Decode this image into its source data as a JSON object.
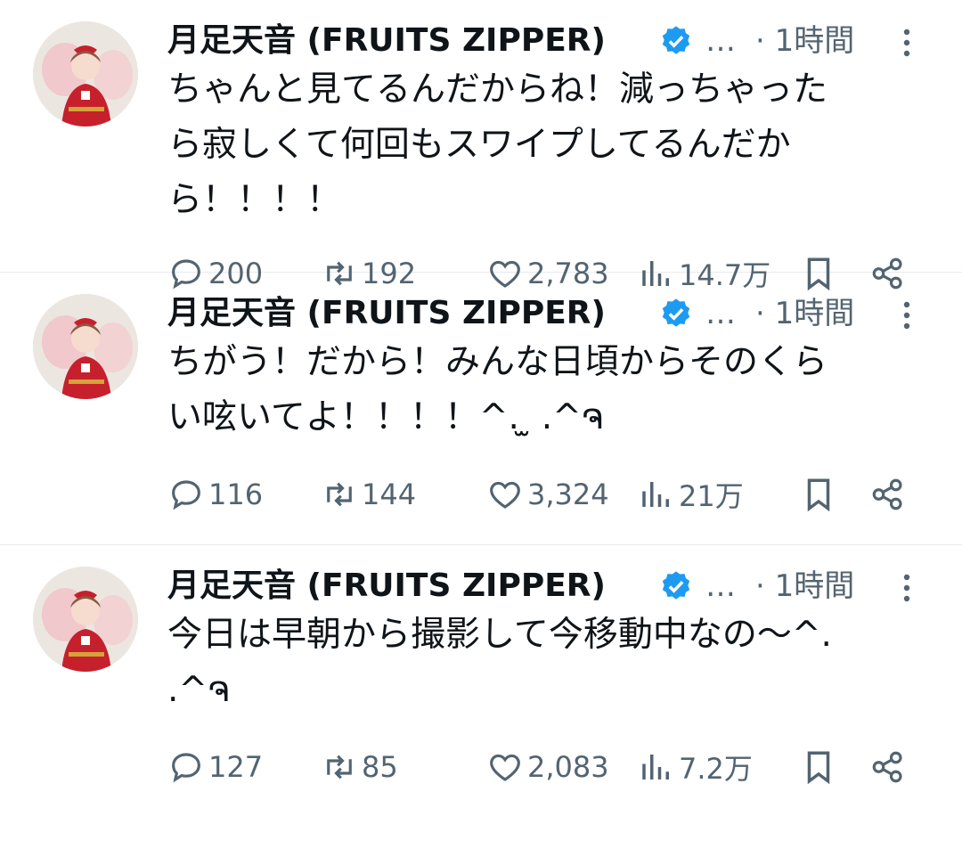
{
  "colors": {
    "text": "#0f1419",
    "secondary": "#536471",
    "verified": "#1d9bf0",
    "divider": "#e6e9ec"
  },
  "icons": {
    "reply": "speech-bubble-icon",
    "retweet": "retweet-arrows-icon",
    "like": "heart-icon",
    "views": "bar-chart-icon",
    "bookmark": "bookmark-icon",
    "share": "share-nodes-icon",
    "more": "vertical-dots-icon",
    "verified": "verified-badge-icon"
  },
  "tweets": [
    {
      "name": "月足天音 (FRUITS ZIPPER)",
      "handle": "…",
      "time": "· 1時間",
      "text": "ちゃんと見てるんだからね！減っちゃった\nら寂しくて何回もスワイプしてるんだか\nら！！！！",
      "replies": "200",
      "retweets": "192",
      "likes": "2,783",
      "views": "14.7万"
    },
    {
      "name": "月足天音 (FRUITS ZIPPER)",
      "handle": "…",
      "time": "· 1時間",
      "text": "ちがう！だから！みんな日頃からそのくら\nい呟いてよ！！！！^. ̫ .^ຈ",
      "replies": "116",
      "retweets": "144",
      "likes": "3,324",
      "views": "21万"
    },
    {
      "name": "月足天音 (FRUITS ZIPPER)",
      "handle": "…",
      "time": "· 1時間",
      "text": "今日は早朝から撮影して今移動中なの〜^.\n.^ຈ",
      "replies": "127",
      "retweets": "85",
      "likes": "2,083",
      "views": "7.2万"
    }
  ]
}
